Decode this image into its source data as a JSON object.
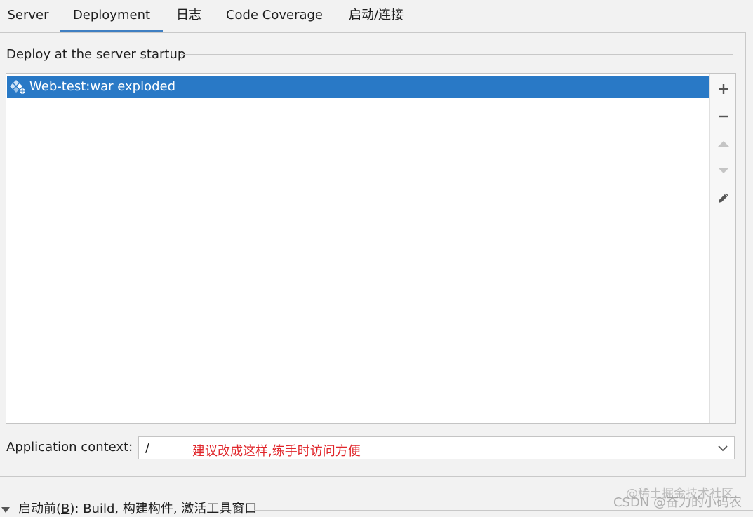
{
  "tabs": [
    {
      "label": "Server",
      "active": false
    },
    {
      "label": "Deployment",
      "active": true
    },
    {
      "label": "日志",
      "active": false
    },
    {
      "label": "Code Coverage",
      "active": false
    },
    {
      "label": "启动/连接",
      "active": false
    }
  ],
  "deploy": {
    "section_title": "Deploy at the server startup",
    "items": [
      {
        "label": "Web-test:war exploded",
        "icon": "artifact-icon",
        "selected": true
      }
    ],
    "toolbar": [
      {
        "name": "add-icon",
        "symbol": "+",
        "enabled": true
      },
      {
        "name": "remove-icon",
        "symbol": "−",
        "enabled": true
      },
      {
        "name": "move-up-icon",
        "symbol": "▲",
        "enabled": false
      },
      {
        "name": "move-down-icon",
        "symbol": "▼",
        "enabled": false
      },
      {
        "name": "edit-icon",
        "symbol": "✎",
        "enabled": true
      }
    ]
  },
  "app_context": {
    "label": "Application context:",
    "value": "/",
    "annotation": "建议改成这样,练手时访问方便"
  },
  "before_launch": {
    "prefix": "启动前(",
    "mnemonic": "B",
    "suffix": "): Build, 构建构件, 激活工具窗口"
  },
  "watermark": {
    "line1": "@稀土掘金技术社区",
    "line2": "CSDN @奋力的小码农"
  },
  "colors": {
    "selection": "#2979c6",
    "tab_underline": "#3f7fc2",
    "annotation": "#e0252a"
  }
}
